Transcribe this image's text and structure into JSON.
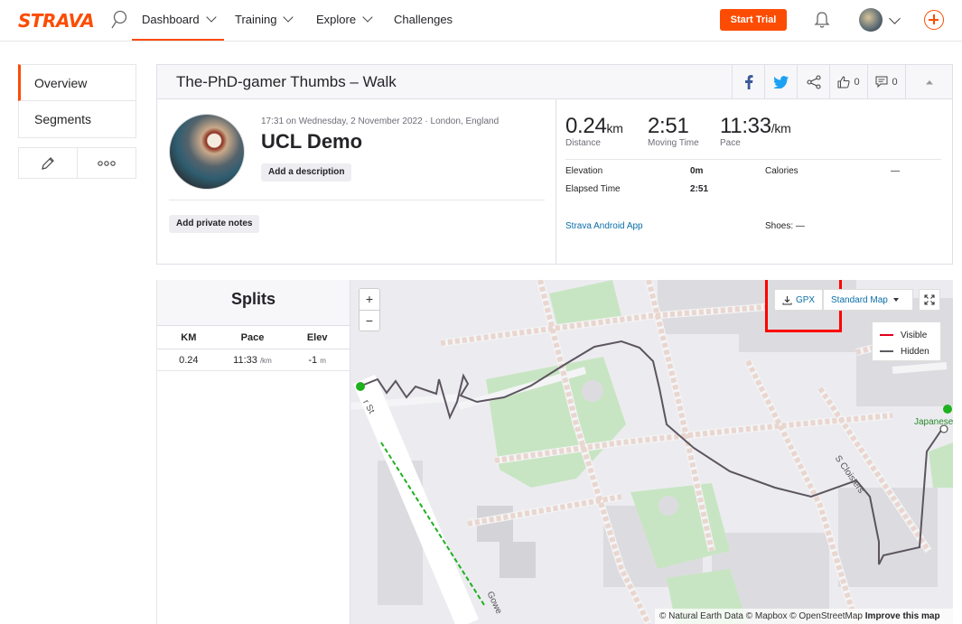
{
  "nav": {
    "logo": "STRAVA",
    "items": [
      "Dashboard",
      "Training",
      "Explore",
      "Challenges"
    ],
    "start_trial": "Start Trial"
  },
  "sidebar": {
    "items": [
      "Overview",
      "Segments"
    ],
    "tools": [
      "edit-icon",
      "more-icon"
    ]
  },
  "activity": {
    "header_title": "The-PhD-gamer Thumbs – Walk",
    "kudos_count": "0",
    "comment_count": "0",
    "datetime": "17:31 on Wednesday, 2 November 2022 · London, England",
    "name": "UCL Demo",
    "add_description": "Add a description",
    "add_private_notes": "Add private notes"
  },
  "stats": {
    "distance": {
      "value": "0.24",
      "unit": "km",
      "label": "Distance"
    },
    "moving_time": {
      "value": "2:51",
      "label": "Moving Time"
    },
    "pace": {
      "value": "11:33",
      "unit": "/km",
      "label": "Pace"
    },
    "elevation_label": "Elevation",
    "elevation_value": "0m",
    "elapsed_label": "Elapsed Time",
    "elapsed_value": "2:51",
    "calories_label": "Calories",
    "calories_value": "—",
    "device": "Strava Android App",
    "shoes": "Shoes: —"
  },
  "splits": {
    "title": "Splits",
    "columns": [
      "KM",
      "Pace",
      "Elev"
    ],
    "rows": [
      {
        "km": "0.24",
        "pace": "11:33",
        "pace_unit": "/km",
        "elev": "-1",
        "elev_unit": "m"
      }
    ]
  },
  "map": {
    "zoom_in": "+",
    "zoom_out": "−",
    "gpx": "GPX",
    "style": "Standard Map",
    "legend": [
      {
        "label": "Visible",
        "color": "#e0001b"
      },
      {
        "label": "Hidden",
        "color": "#5c5c60"
      }
    ],
    "attribution_prefix": "© Natural Earth Data © Mapbox © OpenStreetMap",
    "attribution_link": "Improve this map",
    "street_s_cloisters": "S Cloisters",
    "street_gower": "Gowe",
    "street_st": "r St",
    "poi": "Japanese"
  },
  "colors": {
    "brand": "#fc4c02",
    "link": "#0a6ea8",
    "route": "#5c5560",
    "start": "#1eb11e"
  }
}
